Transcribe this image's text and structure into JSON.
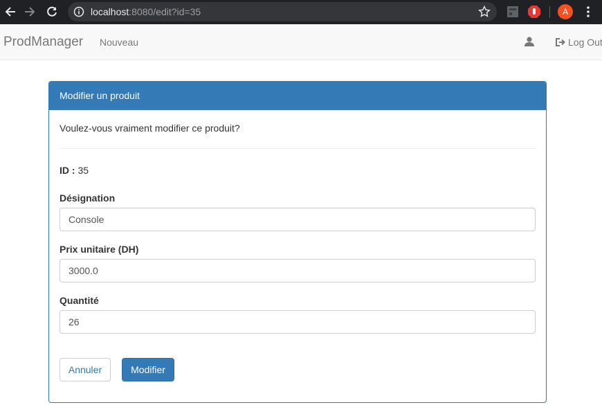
{
  "browser": {
    "url_host": "localhost",
    "url_path": ":8080/edit?id=35",
    "avatar_letter": "A"
  },
  "navbar": {
    "brand": "ProdManager",
    "nav_new": "Nouveau",
    "logout_label": "Log Out"
  },
  "panel": {
    "title": "Modifier un produit",
    "question": "Voulez-vous vraiment modifier ce produit?",
    "id_label": "ID :",
    "id_value": "35",
    "fields": [
      {
        "label": "Désignation",
        "value": "Console"
      },
      {
        "label": "Prix unitaire (DH)",
        "value": "3000.0"
      },
      {
        "label": "Quantité",
        "value": "26"
      }
    ],
    "cancel_label": "Annuler",
    "submit_label": "Modifier"
  },
  "colors": {
    "primary": "#337ab7",
    "chrome_bg": "#202124",
    "navbar_bg": "#f8f8f8"
  },
  "icons": [
    "back-arrow-icon",
    "forward-arrow-icon",
    "reload-icon",
    "info-icon",
    "star-icon",
    "extension-icon",
    "adblock-icon",
    "menu-dots-icon",
    "user-icon",
    "logout-icon"
  ]
}
